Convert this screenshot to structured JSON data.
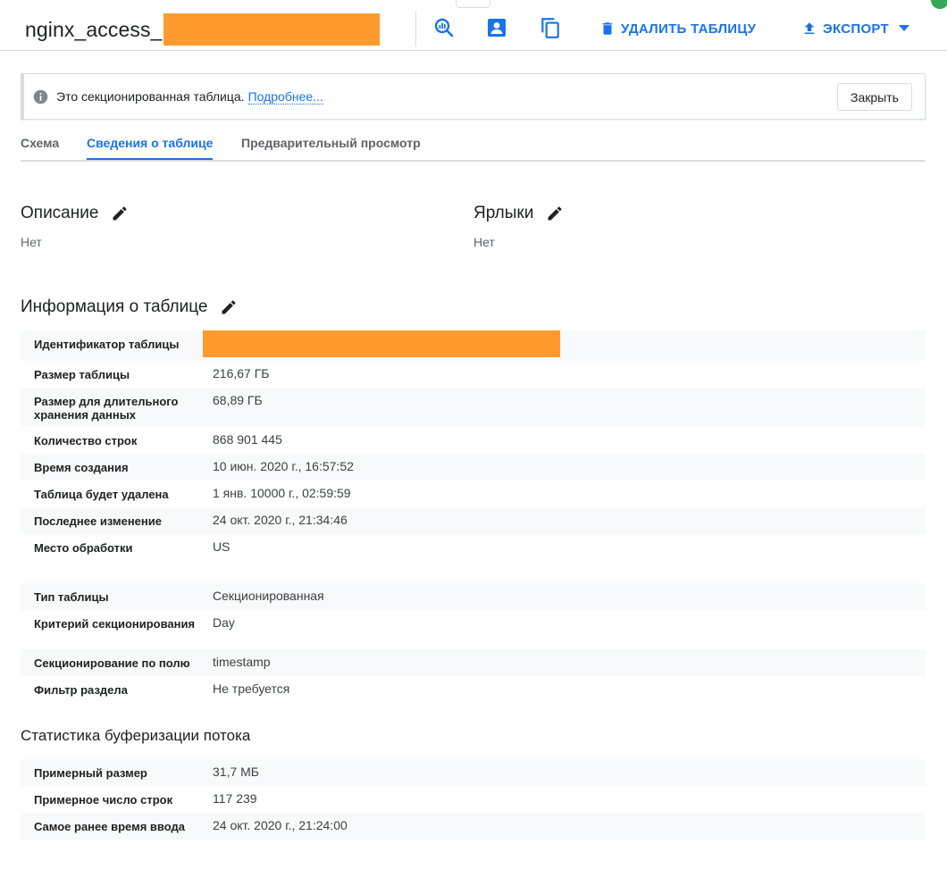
{
  "header": {
    "title": "nginx_access_",
    "query_icon": "query-icon",
    "share_icon": "share-icon",
    "copy_icon": "copy-icon",
    "delete_label": "УДАЛИТЬ ТАБЛИЦУ",
    "export_label": "ЭКСПОРТ"
  },
  "banner": {
    "text": "Это секционированная таблица.",
    "link": "Подробнее...",
    "close_label": "Закрыть"
  },
  "tabs": [
    {
      "label": "Схема",
      "active": false
    },
    {
      "label": "Сведения о таблице",
      "active": true
    },
    {
      "label": "Предварительный просмотр",
      "active": false
    }
  ],
  "description": {
    "title": "Описание",
    "value": "Нет"
  },
  "labels": {
    "title": "Ярлыки",
    "value": "Нет"
  },
  "table_info": {
    "title": "Информация о таблице",
    "rows": [
      {
        "label": "Идентификатор таблицы",
        "value": ""
      },
      {
        "label": "Размер таблицы",
        "value": "216,67 ГБ"
      },
      {
        "label": "Размер для длительного хранения данных",
        "value": "68,89 ГБ"
      },
      {
        "label": "Количество строк",
        "value": "868 901 445"
      },
      {
        "label": "Время создания",
        "value": "10 июн. 2020 г., 16:57:52"
      },
      {
        "label": "Таблица будет удалена",
        "value": "1 янв. 10000 г., 02:59:59"
      },
      {
        "label": "Последнее изменение",
        "value": "24 окт. 2020 г., 21:34:46"
      },
      {
        "label": "Место обработки",
        "value": "US"
      }
    ],
    "partition_rows": [
      {
        "label": "Тип таблицы",
        "value": "Секционированная"
      },
      {
        "label": "Критерий секционирования",
        "value": "Day"
      },
      {
        "label": "Секционирование по полю",
        "value": "timestamp"
      },
      {
        "label": "Фильтр раздела",
        "value": "Не требуется"
      }
    ]
  },
  "streaming": {
    "title": "Статистика буферизации потока",
    "rows": [
      {
        "label": "Примерный размер",
        "value": "31,7 МБ"
      },
      {
        "label": "Примерное число строк",
        "value": "117 239"
      },
      {
        "label": "Самое ранее время ввода",
        "value": "24 окт. 2020 г., 21:24:00"
      }
    ]
  },
  "colors": {
    "accent": "#1a73e8",
    "redaction": "#ff9a2e"
  }
}
